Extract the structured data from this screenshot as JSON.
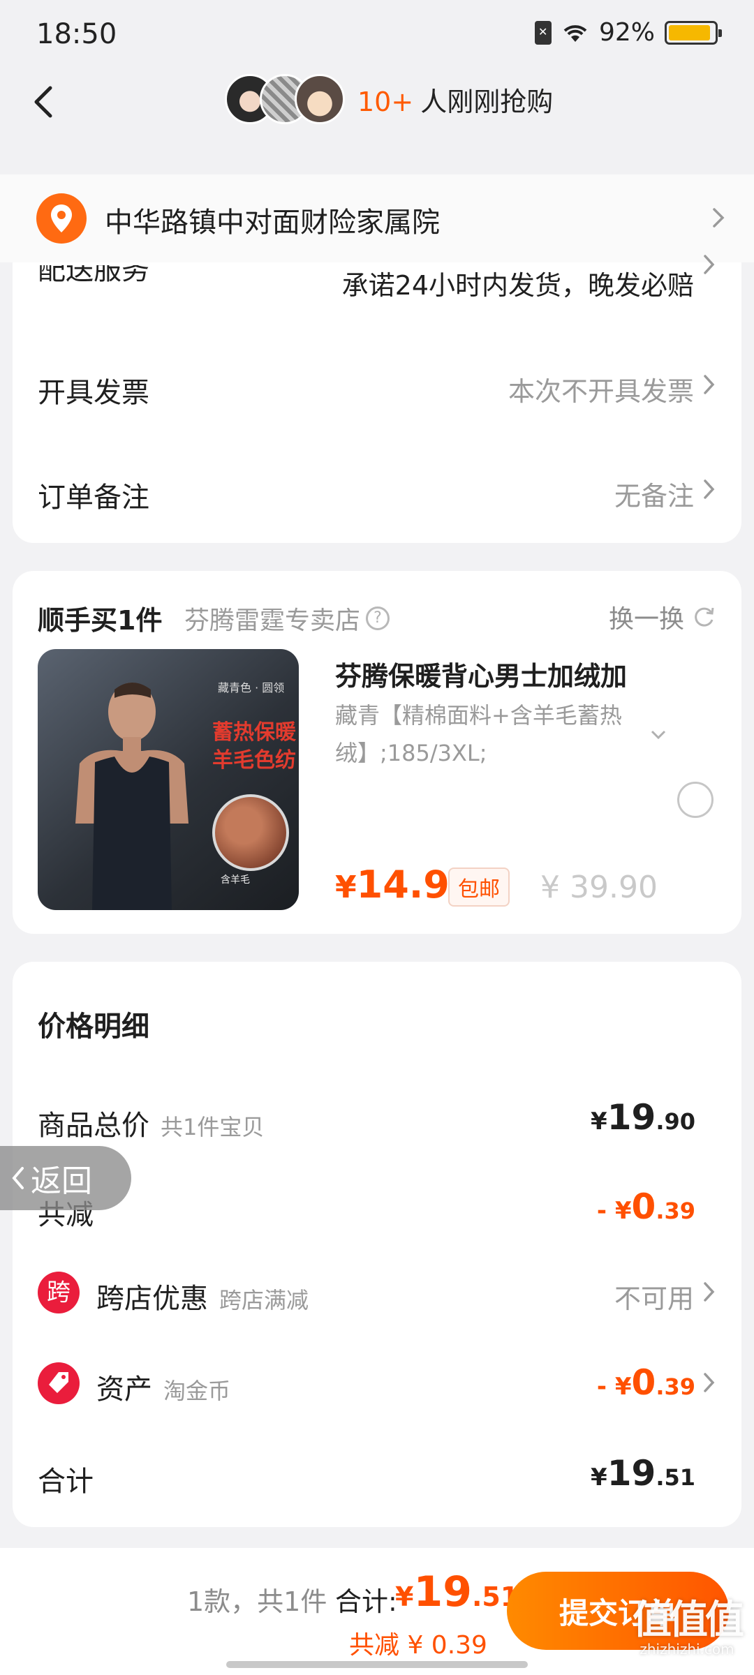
{
  "status_bar": {
    "time": "18:50",
    "battery": "92%",
    "battery_level": 0.92,
    "icons": [
      "sim-off-icon",
      "wifi-icon",
      "battery-icon"
    ]
  },
  "header": {
    "buyers_count": "10+",
    "buyers_text": "人刚刚抢购"
  },
  "address": {
    "text": "中华路镇中对面财险家属院"
  },
  "services": {
    "delivery_label": "配送服务",
    "delivery_value": "承诺24小时内发货，晚发必赔",
    "invoice_label": "开具发票",
    "invoice_value": "本次不开具发票",
    "remark_label": "订单备注",
    "remark_value": "无备注"
  },
  "addon": {
    "title": "顺手买1件",
    "store": "芬腾雷霆专卖店",
    "swap_label": "换一换",
    "product": {
      "image_tag": "藏青色 · 圆领",
      "banner_line1": "蓄热保暖",
      "banner_line2": "羊毛色纺",
      "circle_label": "含羊毛",
      "name": "芬腾保暖背心男士加绒加",
      "spec": "藏青【精棉面料+含羊毛蓄热绒】;185/3XL;",
      "price_symbol": "¥",
      "price": "14.90",
      "badge": "包邮",
      "original_price": "¥ 39.90"
    }
  },
  "price_detail": {
    "title": "价格明细",
    "goods_label": "商品总价",
    "goods_sub": "共1件宝贝",
    "goods_symbol": "¥",
    "goods_int": "19",
    "goods_dec": ".90",
    "discount_label": "共减",
    "discount_symbol": "- ¥",
    "discount_int": "0",
    "discount_dec": ".39",
    "cross_icon": "跨",
    "cross_label": "跨店优惠",
    "cross_sub": "跨店满减",
    "cross_value": "不可用",
    "asset_label": "资产",
    "asset_sub": "淘金币",
    "asset_symbol": "- ¥",
    "asset_int": "0",
    "asset_dec": ".39",
    "total_label": "合计",
    "total_symbol": "¥",
    "total_int": "19",
    "total_dec": ".51"
  },
  "float_back": {
    "label": "返回"
  },
  "bottom_bar": {
    "count_text": "1款，共1件",
    "total_label": "合计:",
    "total_symbol": "¥",
    "total_int": "19",
    "total_dec": ".51",
    "saved_text": "共减 ¥ 0.39",
    "submit_label": "提交订单"
  },
  "watermark": {
    "logo": "值值值",
    "site": "zhizhizhi.com"
  },
  "colors": {
    "accent": "#ff5000",
    "submit_gradient_start": "#ff8a00",
    "submit_gradient_end": "#ff5500",
    "pin": "#ff6a12",
    "cross_icon_bg": "#ea1d3c"
  }
}
